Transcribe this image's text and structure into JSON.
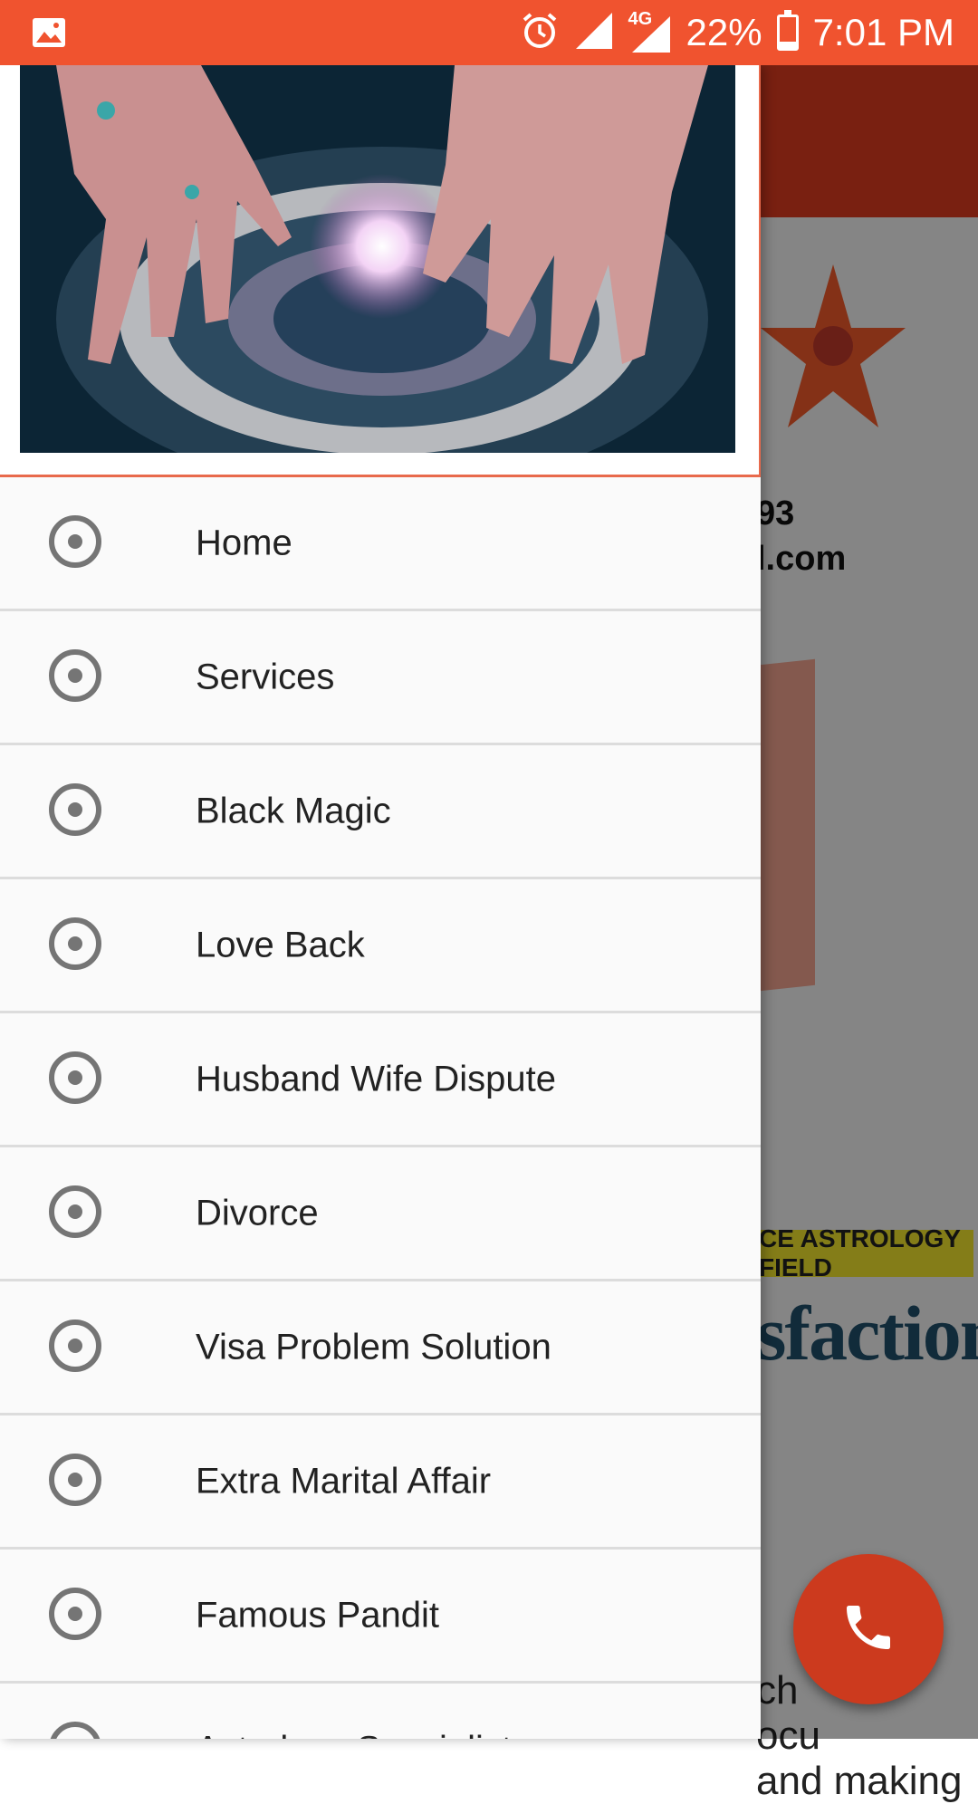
{
  "status_bar": {
    "gallery_icon": "image-icon",
    "alarm_icon": "alarm-icon",
    "network_label": "4G",
    "battery_percent": "22%",
    "battery_level": 0.22,
    "time": "7:01 PM",
    "color": "#f0532f"
  },
  "background_page": {
    "contact_line_1": "93",
    "contact_line_2": "l.com",
    "tag_text": "CE ASTROLOGY FIELD",
    "headline_fragment": "sfaction",
    "paragraph_fragment": "ch\nocu\nand making",
    "appbar_color": "#dd3b1f"
  },
  "drawer": {
    "header_image": "crystal-ball-hands-zodiac-image",
    "accent": "#e86a4c",
    "items": [
      {
        "label": "Home"
      },
      {
        "label": "Services"
      },
      {
        "label": "Black Magic"
      },
      {
        "label": "Love Back"
      },
      {
        "label": "Husband Wife Dispute"
      },
      {
        "label": "Divorce"
      },
      {
        "label": "Visa Problem Solution"
      },
      {
        "label": "Extra Marital Affair"
      },
      {
        "label": "Famous Pandit"
      },
      {
        "label": "Astrology Specialist"
      }
    ]
  },
  "fab": {
    "icon": "phone-icon",
    "color": "#cc3a1e"
  }
}
